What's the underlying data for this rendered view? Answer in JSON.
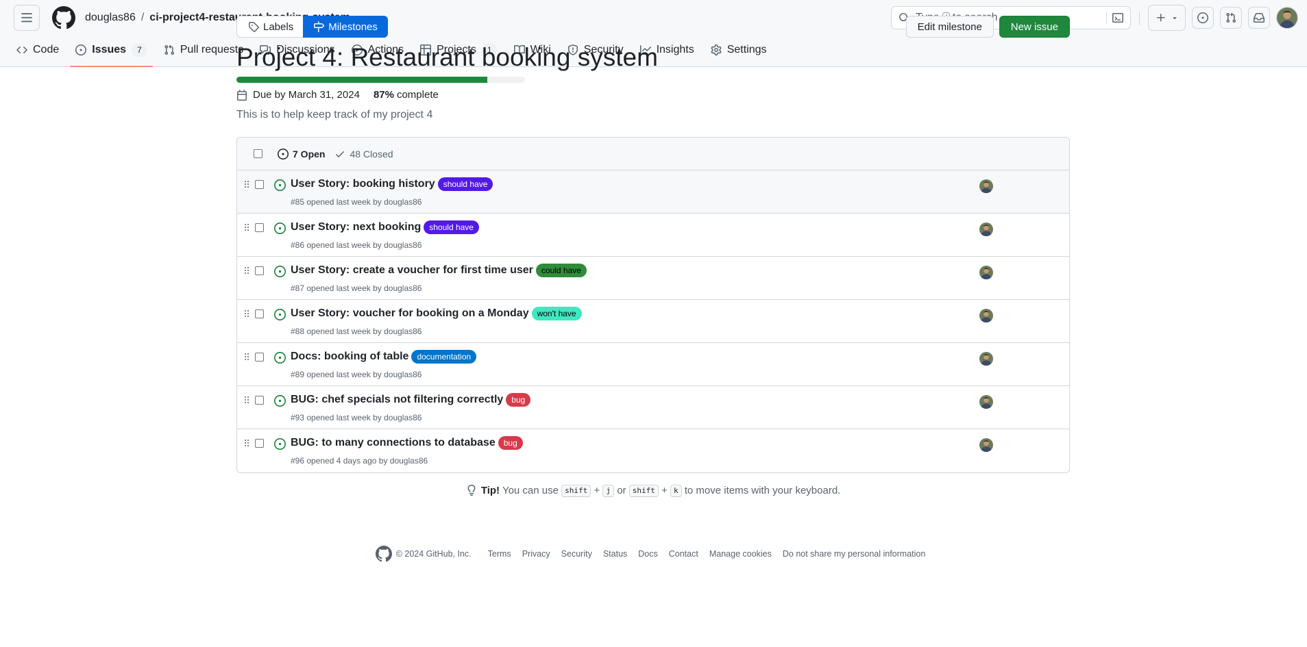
{
  "header": {
    "owner": "douglas86",
    "separator": "/",
    "repo": "ci-project4-restaurant-booking-system",
    "search": {
      "prefix": "Type",
      "key": "/",
      "suffix": "to search"
    }
  },
  "nav": {
    "code": "Code",
    "issues": "Issues",
    "issues_count": "7",
    "pulls": "Pull requests",
    "discussions": "Discussions",
    "actions": "Actions",
    "projects": "Projects",
    "projects_count": "1",
    "wiki": "Wiki",
    "security": "Security",
    "insights": "Insights",
    "settings": "Settings"
  },
  "subnav": {
    "labels": "Labels",
    "milestones": "Milestones"
  },
  "buttons": {
    "edit_milestone": "Edit milestone",
    "new_issue": "New issue"
  },
  "milestone": {
    "title": "Project 4: Restaurant booking system",
    "progress_percent": 87,
    "due": "Due by March 31, 2024",
    "percent_text": "87%",
    "complete_label": "complete",
    "description": "This is to help keep track of my project 4"
  },
  "list": {
    "open": "7 Open",
    "closed": "48 Closed",
    "issues": [
      {
        "title": "User Story: booking history",
        "label": "should have",
        "label_bg": "#5319e7",
        "label_fg": "#ffffff",
        "meta": "#85 opened last week by douglas86"
      },
      {
        "title": "User Story: next booking",
        "label": "should have",
        "label_bg": "#5319e7",
        "label_fg": "#ffffff",
        "meta": "#86 opened last week by douglas86"
      },
      {
        "title": "User Story: create a voucher for first time user",
        "label": "could have",
        "label_bg": "#2f8c3a",
        "label_fg": "#000000",
        "meta": "#87 opened last week by douglas86"
      },
      {
        "title": "User Story: voucher for booking on a Monday",
        "label": "won't have",
        "label_bg": "#3ee8c0",
        "label_fg": "#000000",
        "meta": "#88 opened last week by douglas86"
      },
      {
        "title": "Docs: booking of table",
        "label": "documentation",
        "label_bg": "#0075ca",
        "label_fg": "#ffffff",
        "meta": "#89 opened last week by douglas86"
      },
      {
        "title": "BUG: chef specials not filtering correctly",
        "label": "bug",
        "label_bg": "#d73a4a",
        "label_fg": "#ffffff",
        "meta": "#93 opened last week by douglas86"
      },
      {
        "title": "BUG: to many connections to database",
        "label": "bug",
        "label_bg": "#d73a4a",
        "label_fg": "#ffffff",
        "meta": "#96 opened 4 days ago by douglas86"
      }
    ]
  },
  "tip": {
    "bold": "Tip!",
    "before": "You can use",
    "k1a": "shift",
    "plus": "+",
    "k1b": "j",
    "or": "or",
    "k2a": "shift",
    "k2b": "k",
    "after": "to move items with your keyboard."
  },
  "footer": {
    "copyright": "© 2024 GitHub, Inc.",
    "links": [
      "Terms",
      "Privacy",
      "Security",
      "Status",
      "Docs",
      "Contact",
      "Manage cookies",
      "Do not share my personal information"
    ]
  }
}
